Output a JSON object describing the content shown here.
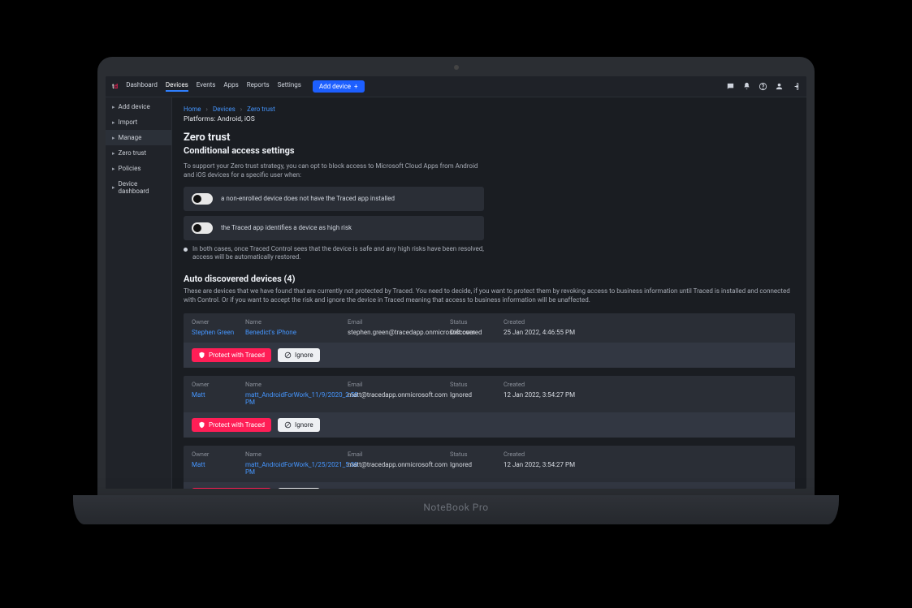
{
  "laptop_label": "NoteBook Pro",
  "logo": {
    "t": "t",
    "d": "d"
  },
  "nav": [
    "Dashboard",
    "Devices",
    "Events",
    "Apps",
    "Reports",
    "Settings"
  ],
  "nav_active_index": 1,
  "add_device_label": "Add device",
  "add_device_plus": "+",
  "sidebar": [
    {
      "label": "Add device",
      "caret": "▸"
    },
    {
      "label": "Import",
      "caret": "▸"
    },
    {
      "label": "Manage",
      "caret": "▸",
      "selected": true
    },
    {
      "label": "Zero trust",
      "caret": "▸"
    },
    {
      "label": "Policies",
      "caret": "▸"
    },
    {
      "label": "Device dashboard",
      "caret": "▸"
    }
  ],
  "breadcrumb": [
    "Home",
    "Devices",
    "Zero trust"
  ],
  "platforms": "Platforms: Android, iOS",
  "page_title": "Zero trust",
  "subtitle": "Conditional access settings",
  "help1": "To support your Zero trust strategy, you can opt to block access to Microsoft Cloud Apps from Android and iOS devices for a specific user when:",
  "toggle1": "a non-enrolled device does not have the Traced app installed",
  "toggle2": "the Traced app identifies a device as high risk",
  "note": "In both cases, once Traced Control sees that the device is safe and any high risks have been resolved, access will be automatically restored.",
  "devices_title": "Auto discovered devices (4)",
  "devices_help": "These are devices that we have found that are currently not protected by Traced. You need to decide, if you want to protect them by revoking access to business information until Traced is installed and connected with Control. Or if you want to accept the risk and ignore the device in Traced meaning that access to business information will be unaffected.",
  "columns": {
    "owner": "Owner",
    "name": "Name",
    "email": "Email",
    "status": "Status",
    "created": "Created"
  },
  "buttons": {
    "protect": "Protect with Traced",
    "ignore": "Ignore"
  },
  "devices": [
    {
      "owner": "Stephen Green",
      "name": "Benedict's iPhone",
      "email": "stephen.green@tracedapp.onmicrosoft.com",
      "status": "Discovered",
      "created": "25 Jan 2022, 4:46:55 PM"
    },
    {
      "owner": "Matt",
      "name": "matt_AndroidForWork_11/9/2020_2:58 PM",
      "email": "matt@tracedapp.onmicrosoft.com",
      "status": "Ignored",
      "created": "12 Jan 2022, 3:54:27 PM"
    },
    {
      "owner": "Matt",
      "name": "matt_AndroidForWork_1/25/2021_5:30 PM",
      "email": "matt@tracedapp.onmicrosoft.com",
      "status": "Ignored",
      "created": "12 Jan 2022, 3:54:27 PM"
    }
  ]
}
